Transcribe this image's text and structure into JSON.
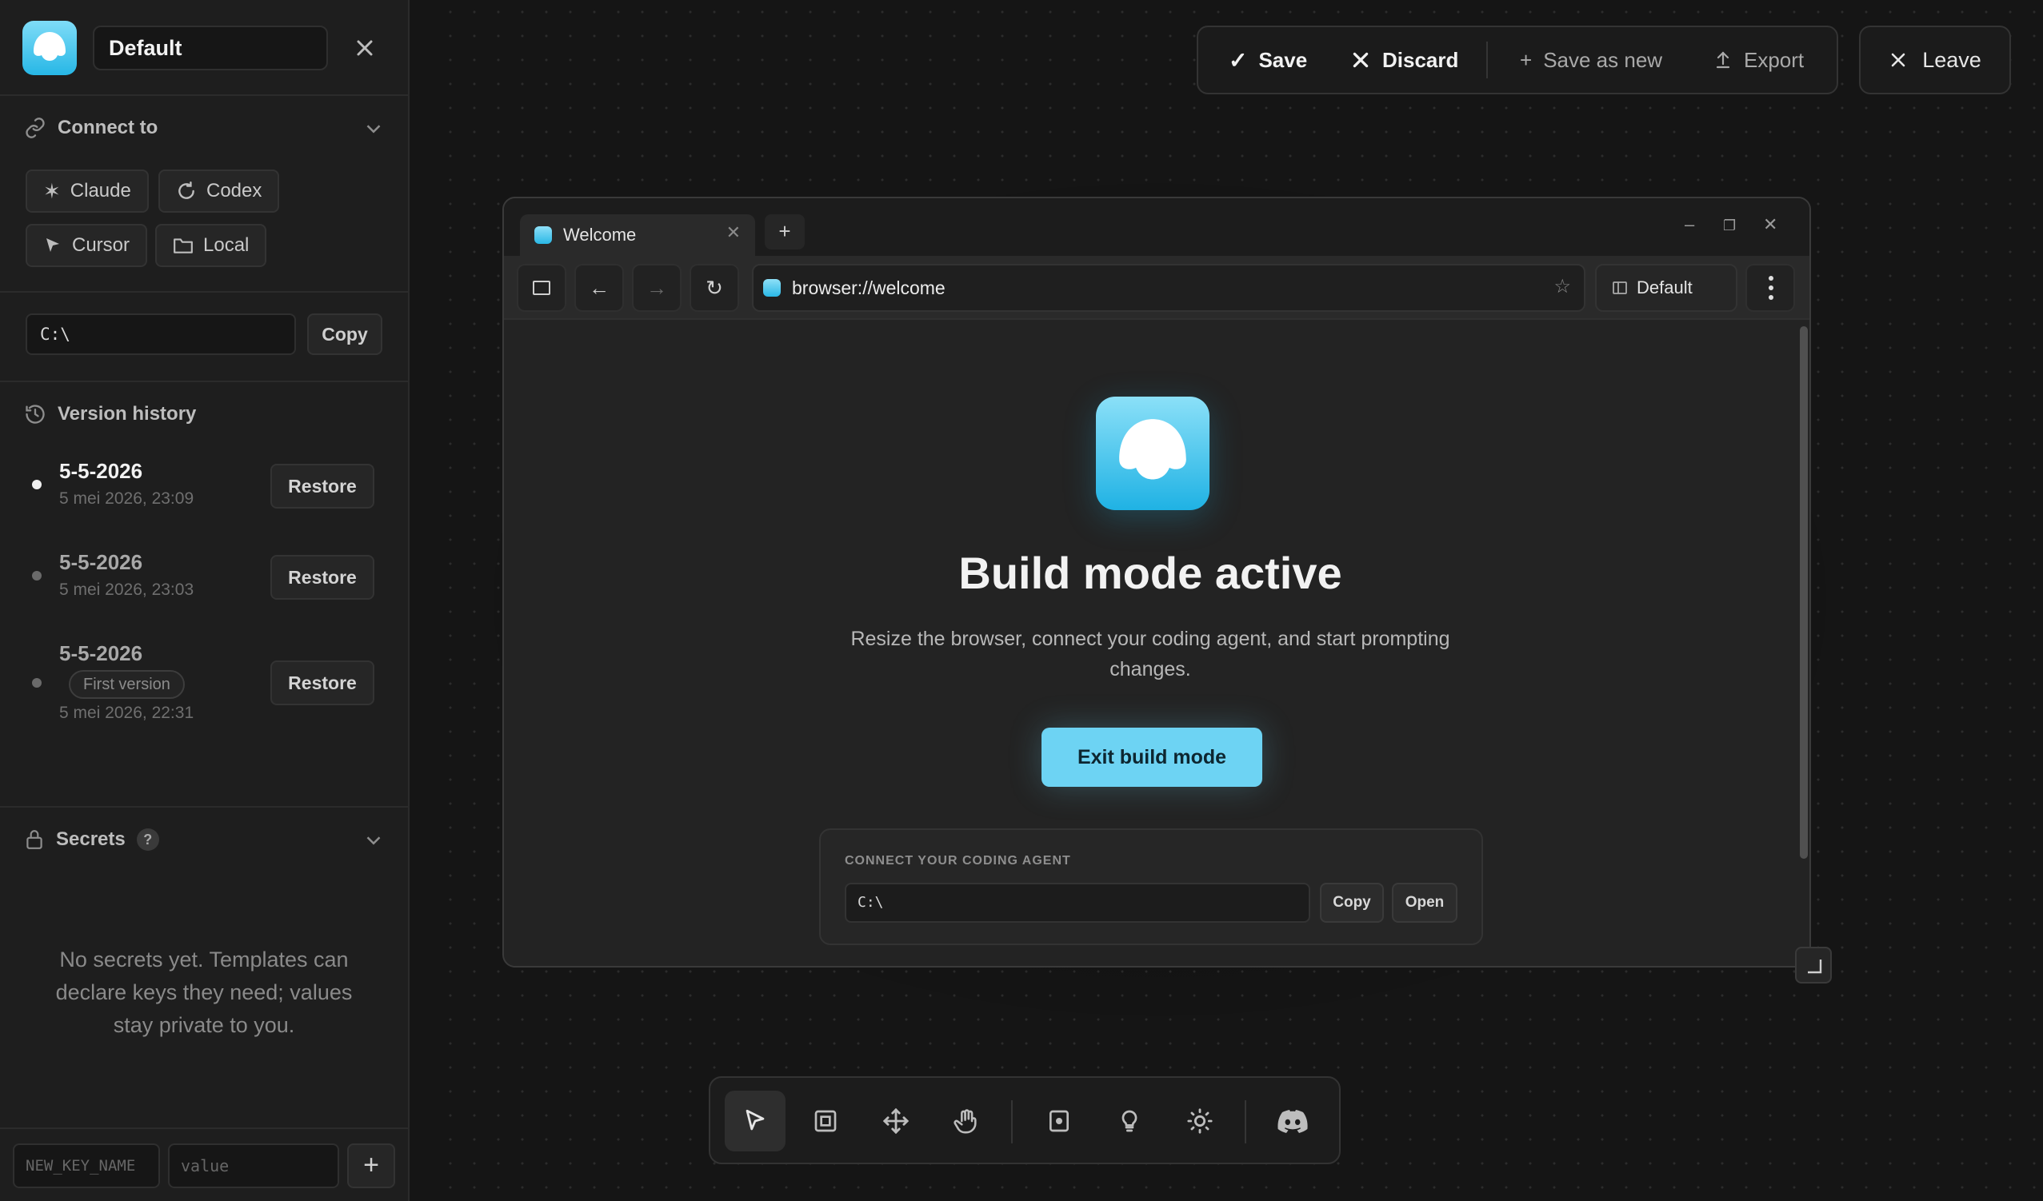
{
  "sidebar": {
    "profile_name": "Default",
    "connect": {
      "title": "Connect to",
      "agents": [
        {
          "label": "Claude",
          "icon": "asterisk-icon"
        },
        {
          "label": "Codex",
          "icon": "refresh-icon"
        },
        {
          "label": "Cursor",
          "icon": "cursor-arrow-icon"
        },
        {
          "label": "Local",
          "icon": "folder-icon"
        }
      ]
    },
    "path": {
      "value": "C:\\",
      "copy_label": "Copy"
    },
    "version_history": {
      "title": "Version history",
      "items": [
        {
          "date": "5-5-2026",
          "time": "5 mei 2026, 23:09",
          "restore_label": "Restore",
          "current": true
        },
        {
          "date": "5-5-2026",
          "time": "5 mei 2026, 23:03",
          "restore_label": "Restore",
          "current": false
        },
        {
          "date": "5-5-2026",
          "badge": "First version",
          "time": "5 mei 2026, 22:31",
          "restore_label": "Restore",
          "current": false
        }
      ]
    },
    "secrets": {
      "title": "Secrets",
      "help": "?",
      "empty": "No secrets yet. Templates can declare keys they need; values stay private to you.",
      "key_placeholder": "NEW_KEY_NAME",
      "value_placeholder": "value",
      "add_label": "+"
    }
  },
  "top_toolbar": {
    "save_label": "Save",
    "discard_label": "Discard",
    "save_new_label": "Save as new",
    "export_label": "Export",
    "leave_label": "Leave"
  },
  "browser": {
    "tab_title": "Welcome",
    "new_tab": "+",
    "url": "browser://welcome",
    "profile": "Default",
    "page": {
      "title": "Build mode active",
      "subtitle": "Resize the browser, connect your coding agent, and start prompting changes.",
      "exit_label": "Exit build mode",
      "connect_label": "CONNECT YOUR CODING AGENT",
      "connect_path": "C:\\",
      "copy_label": "Copy",
      "open_label": "Open"
    }
  },
  "colors": {
    "accent": "#6dd3f3",
    "logo_top": "#8be0f8",
    "logo_bottom": "#1fb2e4",
    "background": "#151515"
  }
}
